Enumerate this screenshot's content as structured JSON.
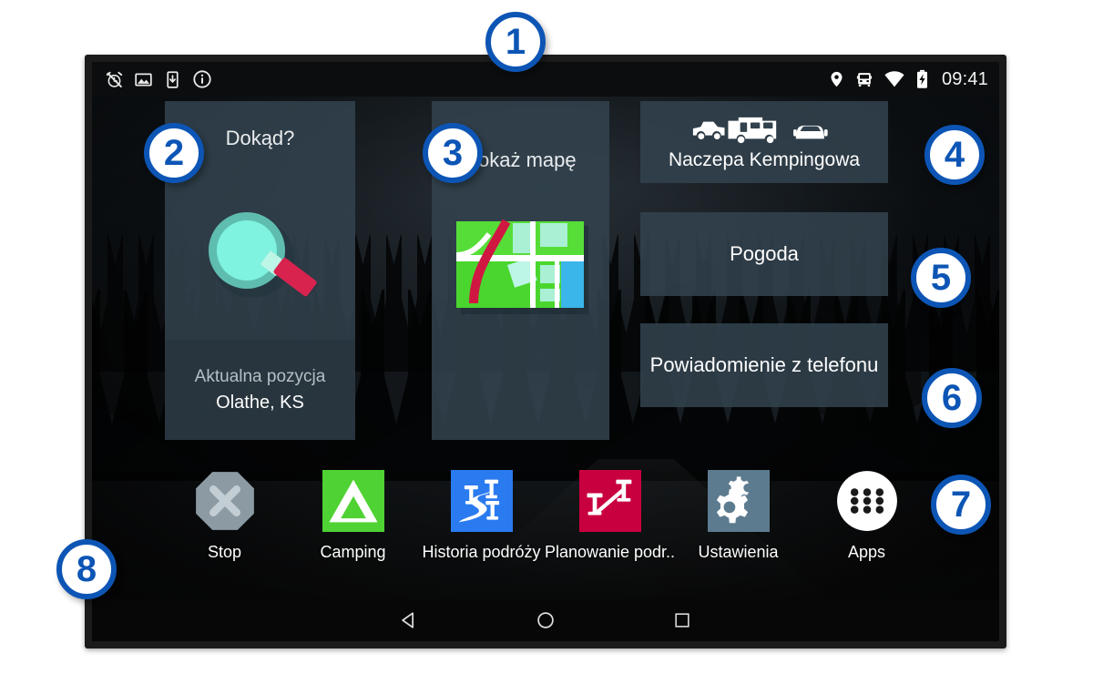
{
  "statusbar": {
    "left_icons": [
      "alarm-off-icon",
      "screenshot-image-icon",
      "download-to-device-icon",
      "info-circle-icon"
    ],
    "right_icons": [
      "location-pin-icon",
      "vehicle-bus-icon",
      "wifi-icon",
      "battery-charging-icon"
    ],
    "clock": "09:41"
  },
  "tiles": {
    "where_to": {
      "title": "Dokąd?",
      "icon": "magnifier-icon",
      "footer_label": "Aktualna pozycja",
      "footer_value": "Olathe, KS"
    },
    "view_map": {
      "title": "Pokaż mapę",
      "icon": "map-thumbnail-icon"
    },
    "vehicle": {
      "label": "Naczepa Kempingowa",
      "icon": "truck-trailer-car-icon"
    },
    "weather": {
      "label": "Pogoda"
    },
    "notification": {
      "label": "Powiadomienie z telefonu"
    }
  },
  "apps": [
    {
      "label": "Stop",
      "icon": "stop-octagon-icon"
    },
    {
      "label": "Camping",
      "icon": "tent-icon"
    },
    {
      "label": "Historia podróży",
      "icon": "trip-history-icon"
    },
    {
      "label": "Planowanie podr..",
      "icon": "trip-planner-icon"
    },
    {
      "label": "Ustawienia",
      "icon": "gears-icon"
    },
    {
      "label": "Apps",
      "icon": "app-drawer-icon"
    }
  ],
  "navbar": [
    {
      "name": "back-button",
      "icon": "back-triangle-icon"
    },
    {
      "name": "home-button",
      "icon": "home-circle-icon"
    },
    {
      "name": "recents-button",
      "icon": "recents-square-icon"
    }
  ],
  "callouts": [
    {
      "number": "1"
    },
    {
      "number": "2"
    },
    {
      "number": "3"
    },
    {
      "number": "4"
    },
    {
      "number": "5"
    },
    {
      "number": "6"
    },
    {
      "number": "7"
    },
    {
      "number": "8"
    }
  ],
  "colors": {
    "callout_blue": "#0d55b5",
    "tile_bg": "#32424d",
    "camping_green": "#4fd233",
    "history_blue": "#2b7bf0",
    "planner_crimson": "#c8003f",
    "settings_slate": "#5d7b8f",
    "magnifier_teal": "#7ff2e0",
    "magnifier_handle": "#d8234f"
  }
}
